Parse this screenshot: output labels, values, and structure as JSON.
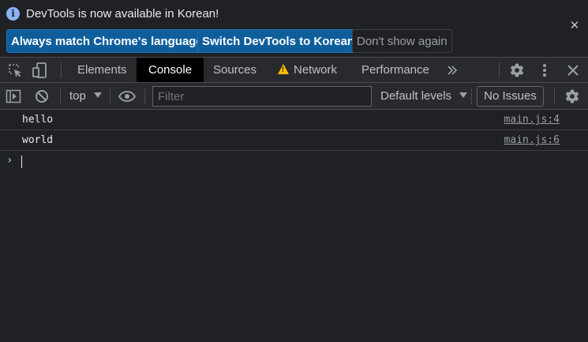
{
  "infobar": {
    "message": "DevTools is now available in Korean!",
    "info_icon": "info-icon",
    "buttons": {
      "match_language": "Always match Chrome's language",
      "switch_korean": "Switch DevTools to Korean",
      "dont_show": "Don't show again"
    },
    "close_icon": "close-icon"
  },
  "tabbar": {
    "tabs": {
      "elements": "Elements",
      "console": "Console",
      "sources": "Sources",
      "network": "Network",
      "performance": "Performance"
    },
    "active_tab": "Console",
    "more_tabs_icon": "double-chevron-icon",
    "icons": [
      "inspect-element-icon",
      "device-toolbar-icon",
      "settings-icon",
      "kebab-menu-icon",
      "close-icon"
    ]
  },
  "console_toolbar": {
    "context": "top",
    "filter_placeholder": "Filter",
    "levels": "Default levels",
    "issues": "No Issues"
  },
  "messages": [
    {
      "text": "hello",
      "source": "main.js:4"
    },
    {
      "text": "world",
      "source": "main.js:6"
    }
  ],
  "colors": {
    "accent_blue": "#8ab4f8",
    "primary_button": "#0f5e9c",
    "warning": "#fbbc04",
    "background": "#202124",
    "toolbar": "#292a2d"
  }
}
